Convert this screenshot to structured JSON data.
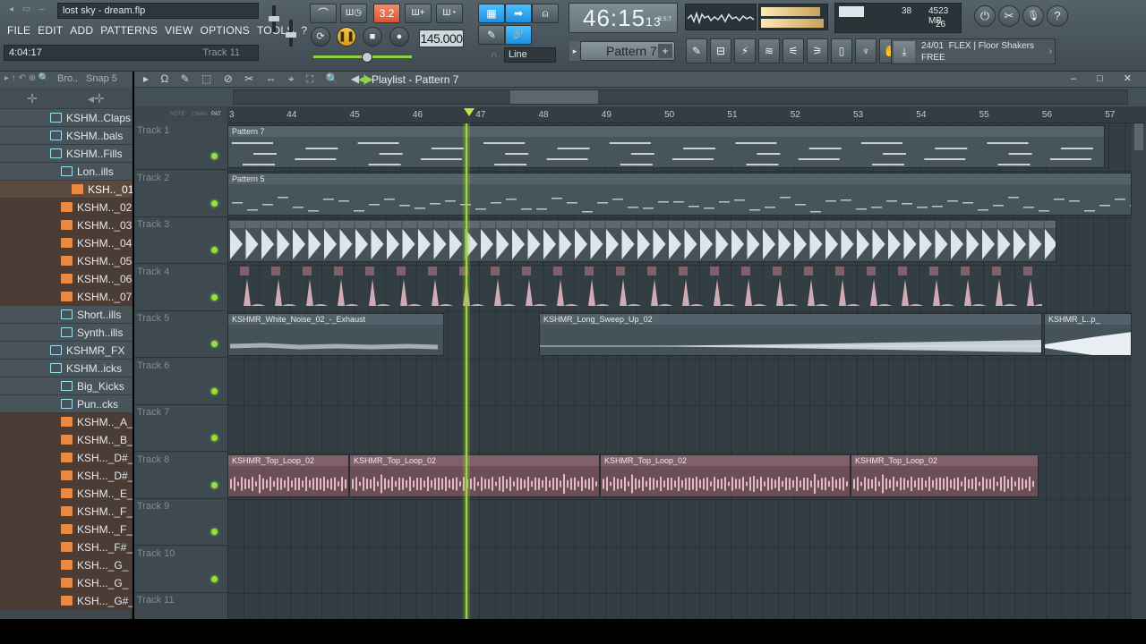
{
  "app": {
    "title": "lost sky - dream.flp",
    "menu": [
      "FILE",
      "EDIT",
      "ADD",
      "PATTERNS",
      "VIEW",
      "OPTIONS",
      "TOOLS",
      "?"
    ],
    "hint_time": "4:04:17",
    "hint_target": "Track 11"
  },
  "transport": {
    "time_main": "46:15",
    "time_sub": "13",
    "time_unit": "B:S:T",
    "tempo": "145.000",
    "pattern": "Pattern 7",
    "snap_mode": "Line",
    "pattern_add": "+",
    "stop_glyph": "■",
    "pause_glyph": "❚❚",
    "record_glyph": "●",
    "loop_glyph": "⟳"
  },
  "toolbar": {
    "tool_glyphs": [
      "✎",
      "⊟",
      "⚡",
      "≋",
      "⚟",
      "⚞",
      "▯",
      "♆",
      "✋"
    ]
  },
  "toggle_buttons": {
    "metronome": "Ш◷",
    "blend": "3.2",
    "step_edit": "Ш+",
    "wait": "Ш◔",
    "typing": "▦",
    "arrow": "➡",
    "mixer": "⍝",
    "pencil": "✎",
    "link": "🔗",
    "pitch": "⏦"
  },
  "monitor": {
    "memory": "4523 MB",
    "cpu_value": "38",
    "polyphony": "26"
  },
  "right_buttons": {
    "power": "⏻",
    "cut": "✂",
    "mic": "🎙",
    "help": "?"
  },
  "news": {
    "date": "24/01",
    "line1": "FLEX | Floor Shakers",
    "line2": "FREE",
    "icon": "⤓",
    "arrow": "›"
  },
  "browser": {
    "header_icons": "▸ ↑ ↶ ⊕ 🔍",
    "header_label": "Bro..",
    "snap_label": "Snap 5",
    "sub_left": "✛",
    "sub_right": "◂✛",
    "items": [
      {
        "label": "KSHM..Claps",
        "type": "folder",
        "indent": 60
      },
      {
        "label": "KSHM..bals",
        "type": "folder",
        "indent": 60
      },
      {
        "label": "KSHM..Fills",
        "type": "folder",
        "indent": 60
      },
      {
        "label": "Lon..ills",
        "type": "folder",
        "indent": 72
      },
      {
        "label": "KSH.._01",
        "type": "file",
        "indent": 84,
        "selected": true
      },
      {
        "label": "KSHM.._02",
        "type": "file",
        "indent": 72
      },
      {
        "label": "KSHM.._03",
        "type": "file",
        "indent": 72
      },
      {
        "label": "KSHM.._04",
        "type": "file",
        "indent": 72
      },
      {
        "label": "KSHM.._05",
        "type": "file",
        "indent": 72
      },
      {
        "label": "KSHM.._06",
        "type": "file",
        "indent": 72
      },
      {
        "label": "KSHM.._07",
        "type": "file",
        "indent": 72
      },
      {
        "label": "Short..ills",
        "type": "folder",
        "indent": 72
      },
      {
        "label": "Synth..ills",
        "type": "folder",
        "indent": 72
      },
      {
        "label": "KSHMR_FX",
        "type": "folder",
        "indent": 60
      },
      {
        "label": "KSHM..icks",
        "type": "folder",
        "indent": 60
      },
      {
        "label": "Big_Kicks",
        "type": "folder",
        "indent": 72
      },
      {
        "label": "Pun..cks",
        "type": "folder",
        "indent": 72
      },
      {
        "label": "KSHM.._A_",
        "type": "file",
        "indent": 72
      },
      {
        "label": "KSHM.._B_",
        "type": "file",
        "indent": 72
      },
      {
        "label": "KSH..._D#_",
        "type": "file",
        "indent": 72
      },
      {
        "label": "KSH..._D#_",
        "type": "file",
        "indent": 72
      },
      {
        "label": "KSHM.._E_",
        "type": "file",
        "indent": 72
      },
      {
        "label": "KSHM.._F_",
        "type": "file",
        "indent": 72
      },
      {
        "label": "KSHM.._F_",
        "type": "file",
        "indent": 72
      },
      {
        "label": "KSH..._F#_",
        "type": "file",
        "indent": 72
      },
      {
        "label": "KSH..._G_",
        "type": "file",
        "indent": 72
      },
      {
        "label": "KSH..._G_",
        "type": "file",
        "indent": 72
      },
      {
        "label": "KSH..._G#_",
        "type": "file",
        "indent": 72
      }
    ]
  },
  "playlist": {
    "title": "Playlist - Pattern 7",
    "tool_glyphs": "▸ Ω ✎ ⬚ ⊘ ✂ ⇔ ⌖ ⛶ 🔍 ◀)",
    "nav_arrow": "◀▶",
    "window_ctrls": "‒ □ ✕",
    "ruler_side_labels": [
      "NOTE",
      "CHAN",
      "PAT"
    ],
    "ruler_labels": [
      "3",
      "44",
      "45",
      "46",
      "47",
      "48",
      "49",
      "50",
      "51",
      "52",
      "53",
      "54",
      "55",
      "56",
      "57"
    ],
    "tracks": [
      "Track 1",
      "Track 2",
      "Track 3",
      "Track 4",
      "Track 5",
      "Track 6",
      "Track 7",
      "Track 8",
      "Track 9",
      "Track 10",
      "Track 11"
    ],
    "clips": {
      "t1": "Pattern 7",
      "t2": "Pattern 5",
      "t5a": "KSHMR_White_Noise_02_-_Exhaust",
      "t5b": "KSHMR_Long_Sweep_Up_02",
      "t5c": "KSHMR_L..p_",
      "t8a": "KSHMR_Top_Loop_02",
      "t8b": "KSHMR_Top_Loop_02",
      "t8c": "KSHMR_Top_Loop_02",
      "t8d": "KSHMR_Top_Loop_02"
    }
  },
  "colors": {
    "accent_green": "#9fd43a",
    "file_orange": "#e98944",
    "folder_cyan": "#9fe0f2",
    "audio_pink": "#f1c4d0"
  }
}
